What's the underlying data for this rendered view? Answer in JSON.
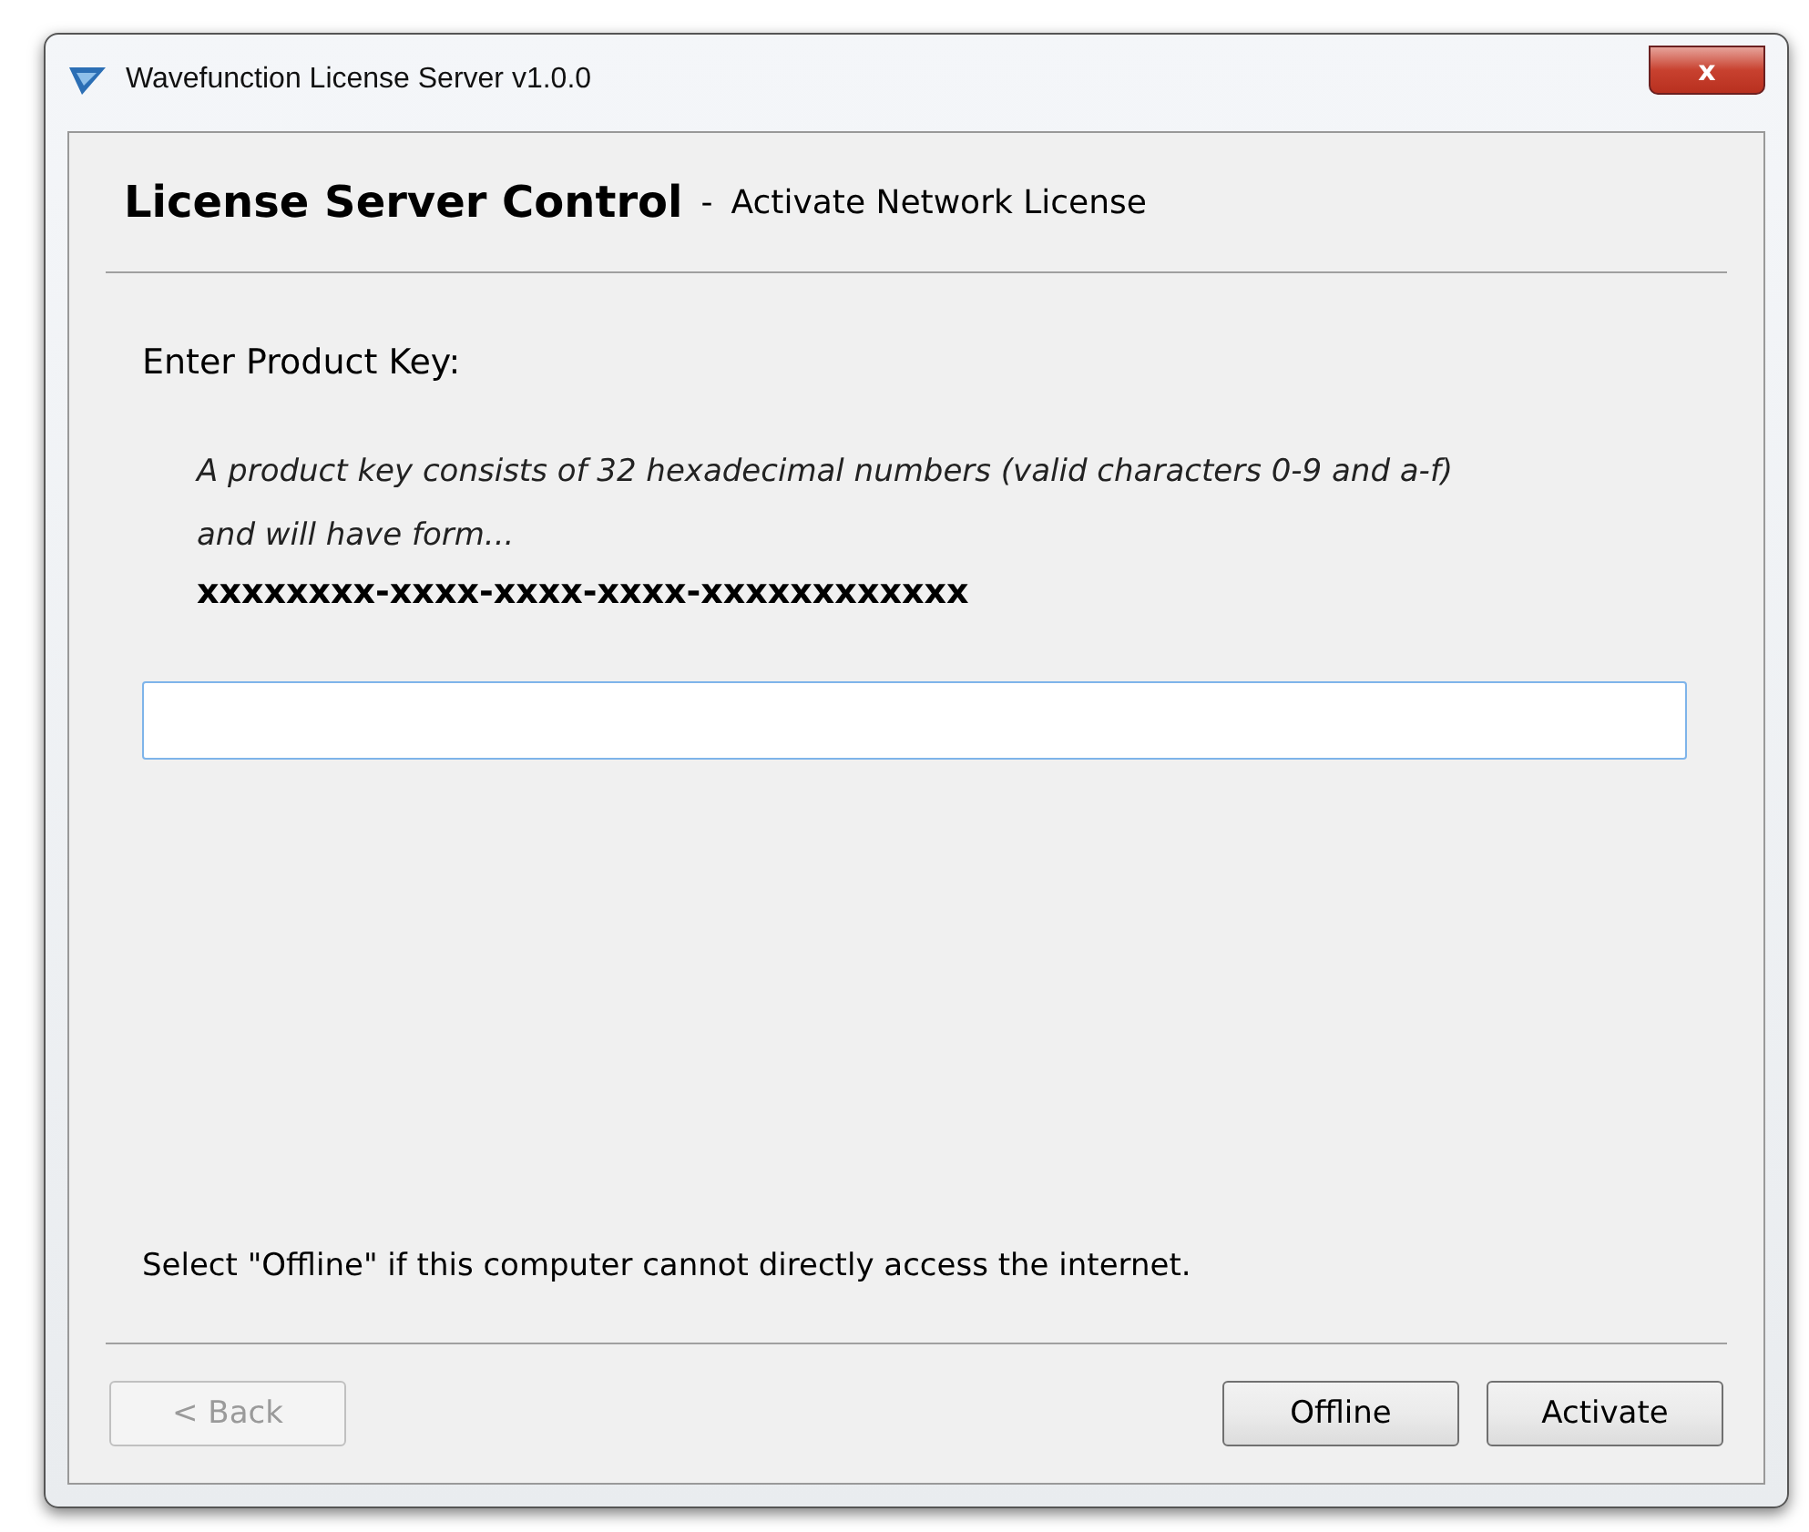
{
  "window": {
    "title": "Wavefunction License Server v1.0.0",
    "close_label": "x"
  },
  "header": {
    "title": "License Server Control",
    "separator": "-",
    "subtitle": "Activate Network License"
  },
  "prompt": "Enter Product Key:",
  "hint": [
    "A product key consists of 32 hexadecimal numbers (valid characters 0-9 and a-f)",
    "and will have form..."
  ],
  "key_format": "xxxxxxxx-xxxx-xxxx-xxxx-xxxxxxxxxxxx",
  "product_key_field": {
    "focused": true
  },
  "offline_note": "Select \"Offline\" if this computer cannot directly access the internet.",
  "back_button": {
    "label": "< Back",
    "disabled": true
  },
  "buttons": [
    {
      "label": "Offline",
      "disabled": false
    },
    {
      "label": "Activate",
      "disabled": false
    }
  ]
}
